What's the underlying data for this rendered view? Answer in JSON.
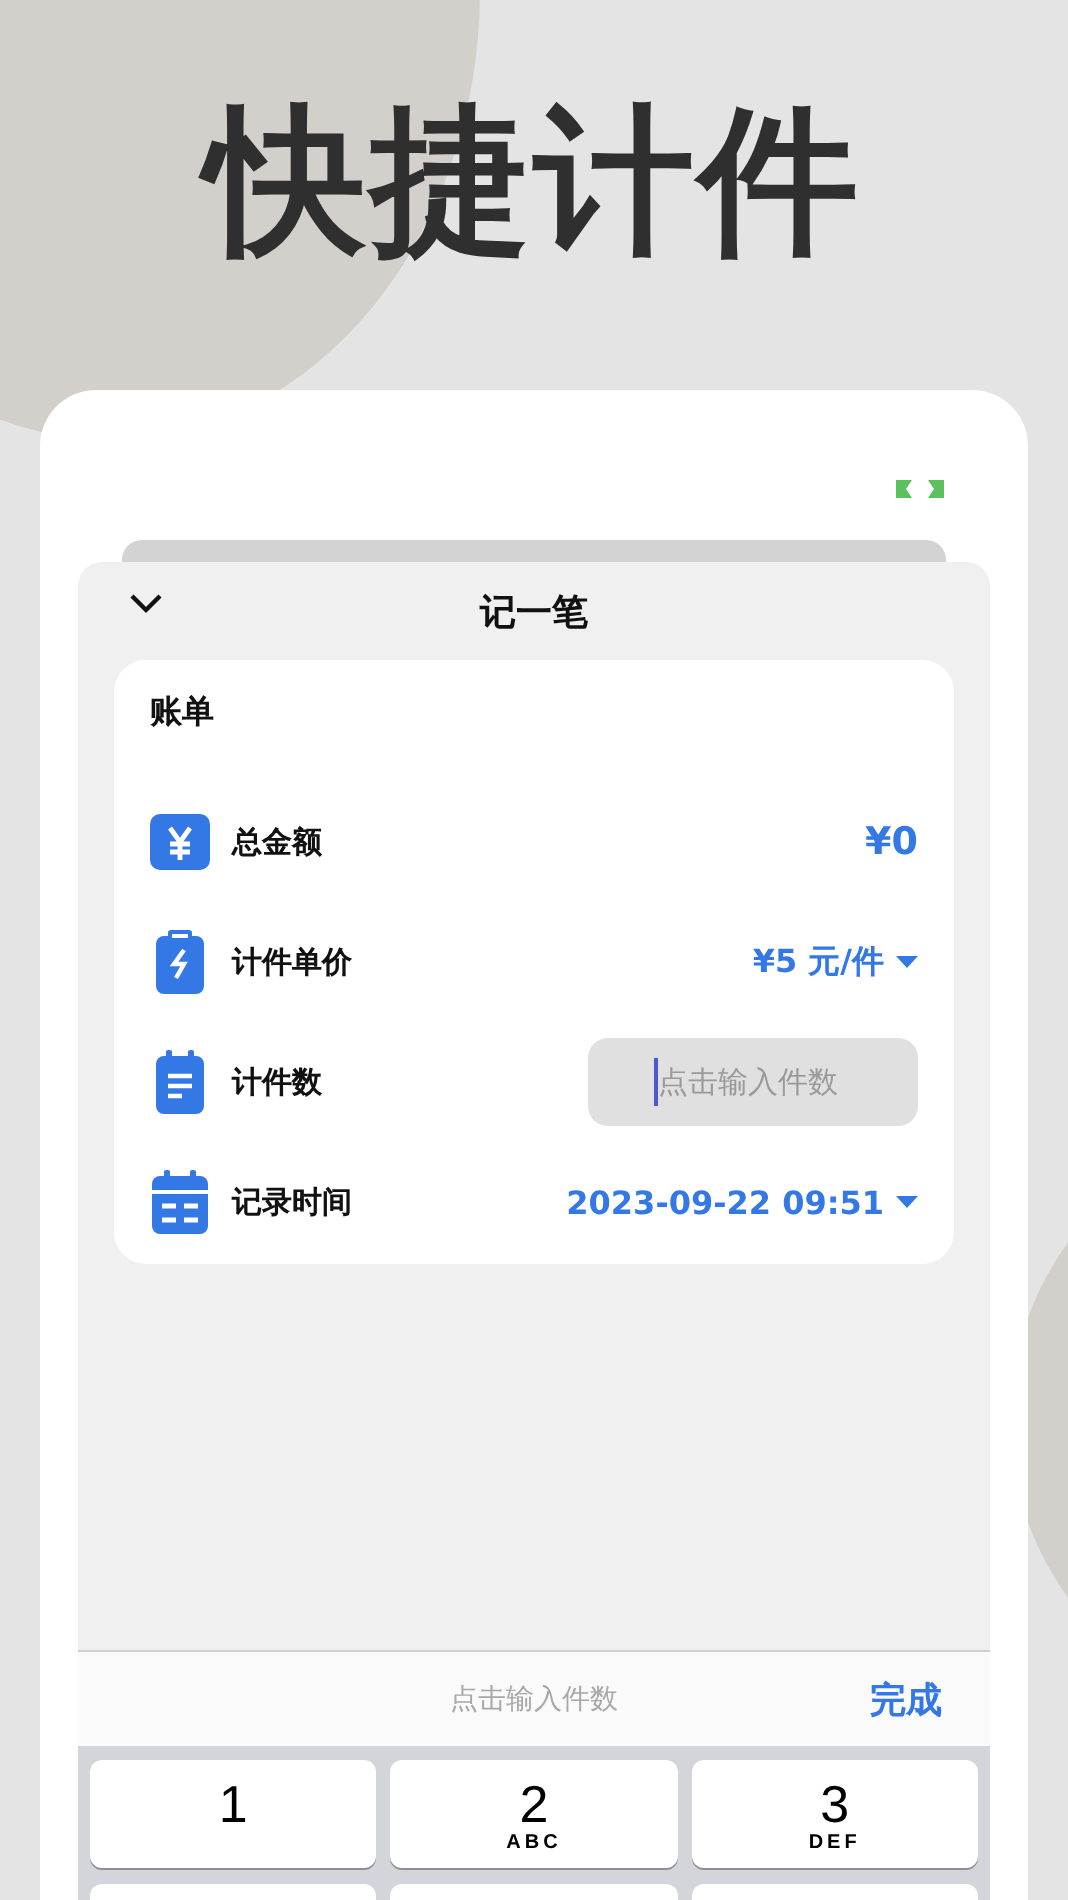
{
  "headline": "快捷计件",
  "sheet": {
    "title": "记一笔"
  },
  "bill": {
    "title": "账单",
    "rows": [
      {
        "kind": "amount",
        "label": "总金额",
        "value": "¥0"
      },
      {
        "kind": "dropdown",
        "label": "计件单价",
        "value": "¥5 元/件"
      },
      {
        "kind": "input",
        "label": "计件数",
        "placeholder": "点击输入件数"
      },
      {
        "kind": "dropdown",
        "label": "记录时间",
        "value": "2023-09-22 09:51"
      }
    ]
  },
  "keyboard": {
    "toolbar_placeholder": "点击输入件数",
    "done": "完成",
    "keys": [
      {
        "digit": "1"
      },
      {
        "digit": "2",
        "letters": "ABC"
      },
      {
        "digit": "3",
        "letters": "DEF"
      }
    ]
  }
}
